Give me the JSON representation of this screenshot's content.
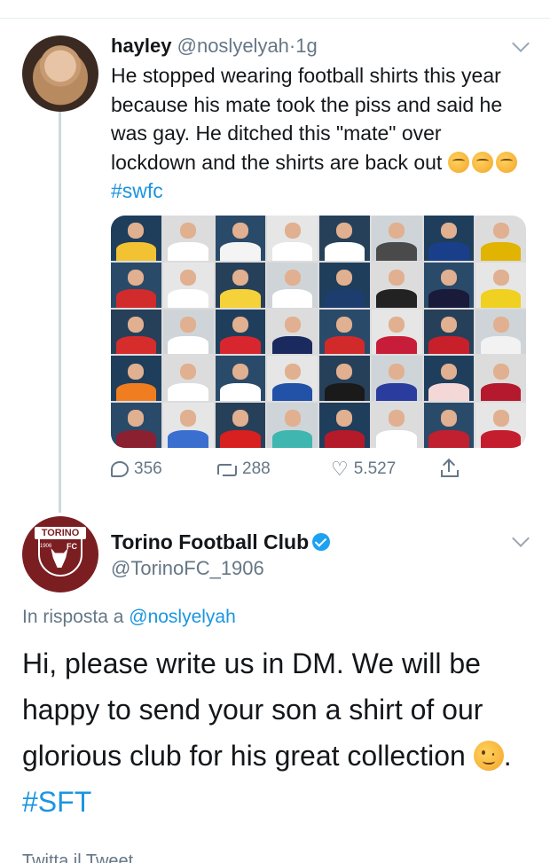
{
  "tweet1": {
    "display_name": "hayley",
    "handle": "@noslyelyah",
    "separator": "·",
    "time": "1g",
    "text_main": "He stopped wearing football shirts this year because his mate took the piss and said he was gay. He ditched this \"mate\" over lockdown and the shirts are back out ",
    "hashtag": "#swfc",
    "emoji": [
      "smiling-face-with-hearts",
      "smiling-face-with-hearts",
      "smiling-face-with-hearts"
    ],
    "media_alt": "grid of photos of a boy wearing football shirts",
    "media_grid": {
      "rows": 5,
      "cols": 8,
      "shirt_colors": [
        "#f2c232",
        "#ffffff",
        "#f4f4f4",
        "#ffffff",
        "#ffffff",
        "#4a4a4a",
        "#1a3f8a",
        "#e0b400",
        "#d12b2b",
        "#ffffff",
        "#f6d23a",
        "#ffffff",
        "#1c3d6e",
        "#222222",
        "#1a1a3a",
        "#f0d020",
        "#d62c2c",
        "#ffffff",
        "#d8262e",
        "#1b2a5e",
        "#d22a2a",
        "#c81d3a",
        "#c8202a",
        "#f2f2f2",
        "#f07d20",
        "#ffffff",
        "#ffffff",
        "#2251a8",
        "#1a1a1a",
        "#2a3c9e",
        "#f4d8d8",
        "#b5192d",
        "#8a2030",
        "#3a6fd0",
        "#d82020",
        "#3fb6b0",
        "#b51a2a",
        "#ffffff",
        "#c02030",
        "#c41e2e"
      ]
    },
    "stats": {
      "replies": "356",
      "retweets": "288",
      "likes": "5.527"
    }
  },
  "tweet2": {
    "display_name": "Torino Football Club",
    "handle": "@TorinoFC_1906",
    "verified": true,
    "reply_prefix": "In risposta a",
    "reply_to": "@noslyelyah",
    "text_main": "Hi, please write us in DM. We will be happy to send your son a shirt of our glorious club for his great collection ",
    "text_after_emoji": ". ",
    "hashtag": "#SFT",
    "emoji": "winking-face",
    "avatar_logo": {
      "word": "TORINO",
      "fc": "FC",
      "year": "1906",
      "color": "#7b1e22"
    }
  },
  "footer_cut_text": "Twitta il Tweet",
  "colors": {
    "link": "#1b95e0",
    "secondary": "#657786",
    "verified": "#1da1f2"
  }
}
